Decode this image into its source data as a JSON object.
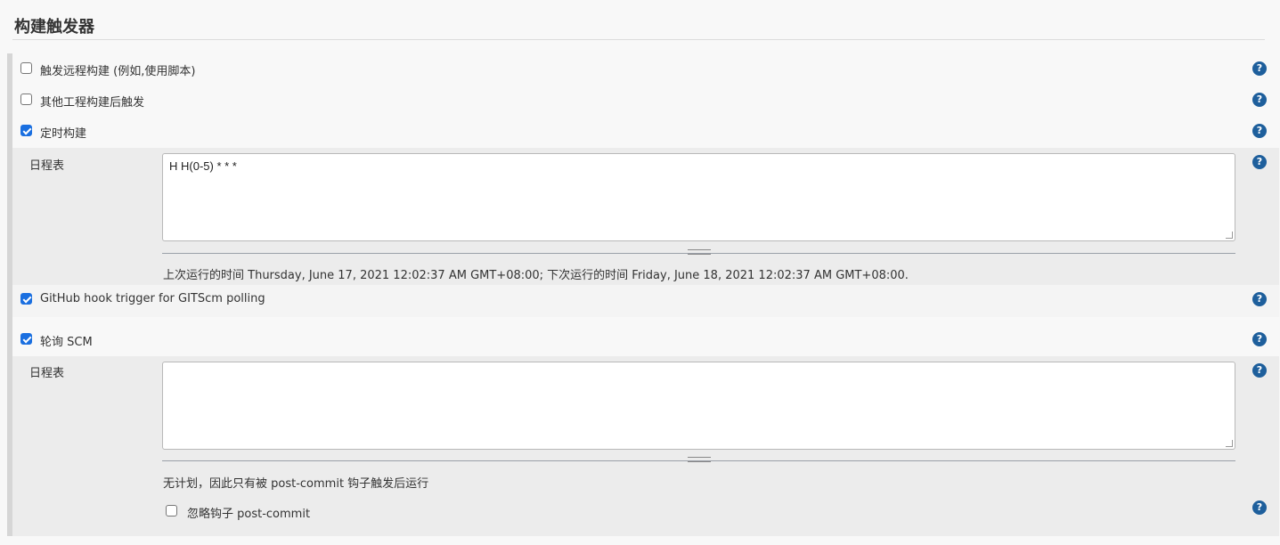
{
  "section": {
    "title": "构建触发器"
  },
  "triggers": {
    "remote": {
      "label": "触发远程构建 (例如,使用脚本)",
      "checked": false
    },
    "after_other": {
      "label": "其他工程构建后触发",
      "checked": false
    },
    "timer": {
      "label": "定时构建",
      "checked": true,
      "schedule_label": "日程表",
      "schedule_value": "H H(0-5) * * *",
      "info": "上次运行的时间 Thursday, June 17, 2021 12:02:37 AM GMT+08:00; 下次运行的时间 Friday, June 18, 2021 12:02:37 AM GMT+08:00."
    },
    "github_hook": {
      "label": "GitHub hook trigger for GITScm polling",
      "checked": true
    },
    "poll_scm": {
      "label": "轮询 SCM",
      "checked": true,
      "schedule_label": "日程表",
      "schedule_value": "",
      "info": "无计划，因此只有被 post-commit 钩子触发后运行",
      "ignore_hooks": {
        "label": "忽略钩子 post-commit",
        "checked": false
      }
    }
  },
  "help": {
    "glyph": "?"
  },
  "colors": {
    "checkbox_on": "#1a6fe0",
    "help_icon": "#1e5f9c"
  }
}
